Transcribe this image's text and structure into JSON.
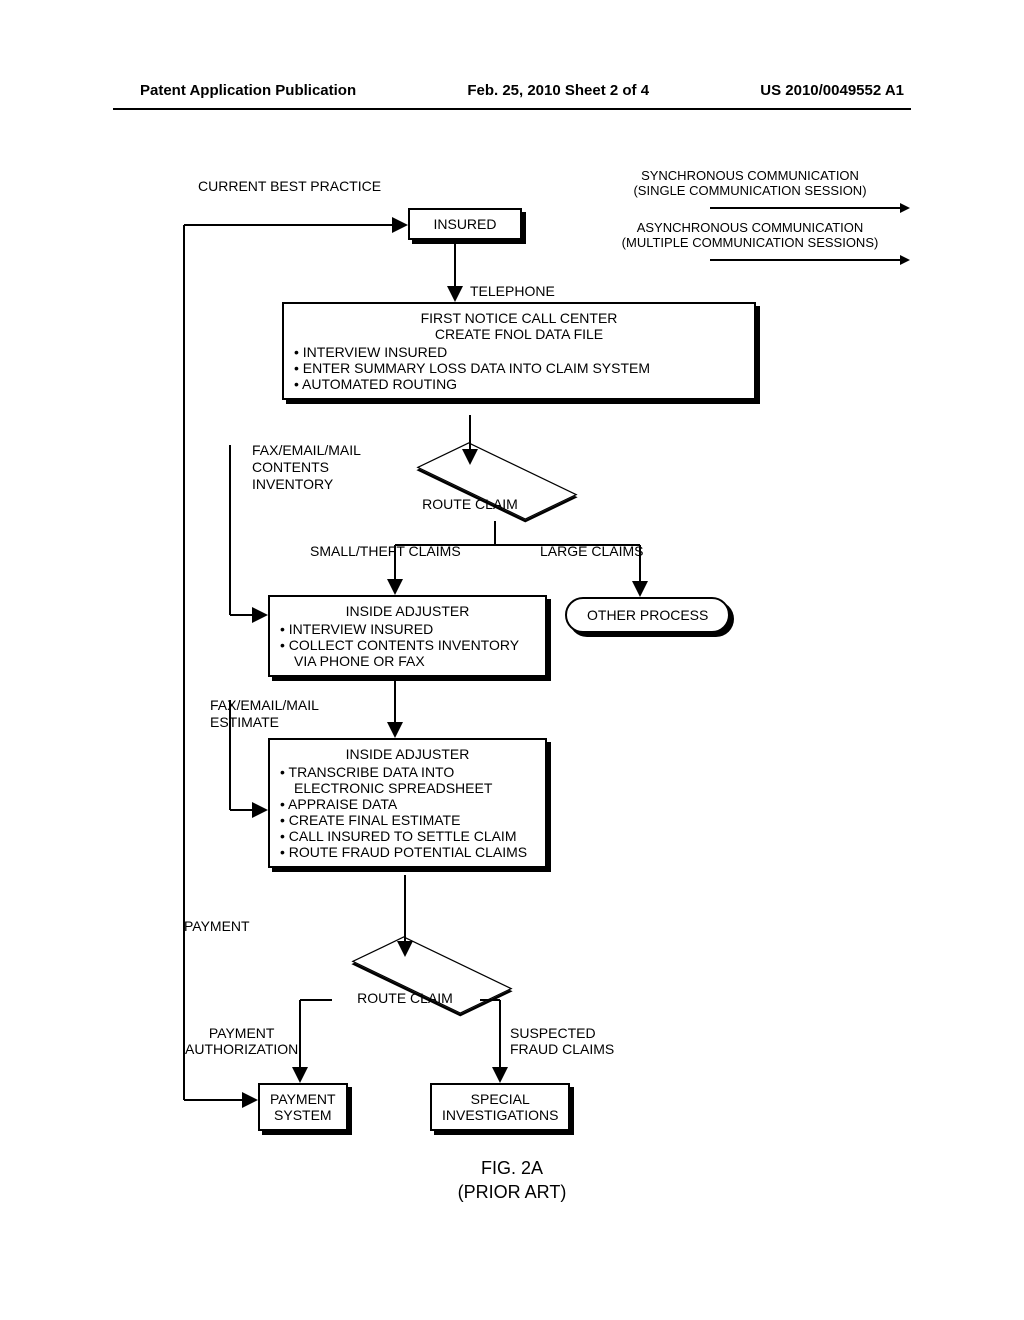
{
  "header": {
    "left": "Patent Application Publication",
    "center": "Feb. 25, 2010  Sheet 2 of 4",
    "right": "US 2010/0049552 A1"
  },
  "heading_left": "CURRENT BEST PRACTICE",
  "legend": {
    "sync1": "SYNCHRONOUS COMMUNICATION",
    "sync2": "(SINGLE COMMUNICATION SESSION)",
    "async1": "ASYNCHRONOUS COMMUNICATION",
    "async2": "(MULTIPLE COMMUNICATION SESSIONS)"
  },
  "boxes": {
    "insured": "INSURED",
    "telephone_label": "TELEPHONE",
    "fnol": {
      "t1": "FIRST NOTICE CALL CENTER",
      "t2": "CREATE FNOL DATA FILE",
      "b1": "INTERVIEW INSURED",
      "b2": "ENTER SUMMARY LOSS DATA INTO CLAIM SYSTEM",
      "b3": "AUTOMATED ROUTING"
    },
    "route1": "ROUTE CLAIM",
    "route_left": "SMALL/THEFT CLAIMS",
    "route_right": "LARGE CLAIMS",
    "other_process": "OTHER PROCESS",
    "adjuster1": {
      "t": "INSIDE ADJUSTER",
      "b1": "INTERVIEW INSURED",
      "b2": "COLLECT CONTENTS INVENTORY",
      "b3": "VIA PHONE OR FAX"
    },
    "adjuster2": {
      "t": "INSIDE ADJUSTER",
      "b1": "TRANSCRIBE DATA INTO",
      "b1b": "ELECTRONIC SPREADSHEET",
      "b2": "APPRAISE DATA",
      "b3": "CREATE FINAL ESTIMATE",
      "b4": "CALL INSURED TO SETTLE CLAIM",
      "b5": "ROUTE FRAUD POTENTIAL CLAIMS"
    },
    "route2": "ROUTE CLAIM",
    "route2_left1": "PAYMENT",
    "route2_left2": "AUTHORIZATION",
    "route2_right1": "SUSPECTED",
    "route2_right2": "FRAUD CLAIMS",
    "payment_system1": "PAYMENT",
    "payment_system2": "SYSTEM",
    "investigations1": "SPECIAL",
    "investigations2": "INVESTIGATIONS"
  },
  "side": {
    "inv1": "FAX/EMAIL/MAIL",
    "inv2": "CONTENTS",
    "inv3": "INVENTORY",
    "est1": "FAX/EMAIL/MAIL",
    "est2": "ESTIMATE",
    "payment": "PAYMENT"
  },
  "figure": {
    "num": "FIG. 2A",
    "sub": "(PRIOR ART)"
  }
}
